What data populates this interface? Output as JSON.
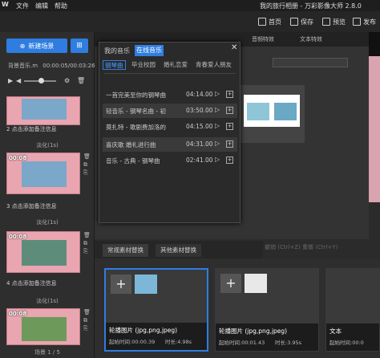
{
  "titlebar": {
    "logo": "W",
    "menus": [
      "文件",
      "编辑",
      "帮助"
    ],
    "title": "我的旅行相册 - 万彩影像大师 2.8.0"
  },
  "toolbar": {
    "home": "首页",
    "save": "保存",
    "preview": "预览",
    "publish": "发布"
  },
  "left": {
    "new_scene": "新建场景",
    "music_label": "背景音乐.m",
    "music_time": "00:00:05/00:03:26",
    "scenes": [
      {
        "caption": "2 点击添加备注信息",
        "time": "",
        "transition": "淡化(1s)"
      },
      {
        "caption": "3 点击添加备注信息",
        "time": "00:08",
        "transition": "淡化(1s)"
      },
      {
        "caption": "4 点击添加备注信息",
        "time": "00:08",
        "transition": "淡化(1s)"
      },
      {
        "caption": "",
        "time": "00:08",
        "transition": ""
      }
    ],
    "footer": "场景 1 / 5"
  },
  "top_tabs": [
    "音频特效",
    "文本特效"
  ],
  "dialog": {
    "tab_my": "我的音乐",
    "tab_online": "在线音乐",
    "close": "✕",
    "categories": [
      "钢琴曲",
      "毕业校园",
      "婚礼恋爱",
      "青春爱人朋友"
    ],
    "songs": [
      {
        "name": "一首完美至你的钢琴曲",
        "time": "04:14.00"
      },
      {
        "name": "轻音乐 - 钢琴名曲 - 初",
        "time": "03:50.00"
      },
      {
        "name": "莫扎特 - 歌剧费加洛的",
        "time": "04:15.00"
      },
      {
        "name": "喜庆歌 婚礼进行曲",
        "time": "04:31.00"
      },
      {
        "name": "音乐 - 古典 - 钢琴曲",
        "time": "02:41.00"
      }
    ]
  },
  "undo_row": "撤销 (Ctrl+Z)     重做 (Ctrl+Y)",
  "material_tabs": [
    "常规素材替换",
    "其他素材替换"
  ],
  "cards": [
    {
      "title": "轮播图片 (jpg,png,jpeg)",
      "start": "起始时间:00:00.39",
      "duration": "时长:4.98s"
    },
    {
      "title": "轮播图片 (jpg,png,jpeg)",
      "start": "起始时间:00:01.43",
      "duration": "时长:3.95s"
    },
    {
      "title": "文本",
      "start": "起始时间:00:0",
      "duration": ""
    }
  ],
  "colors": {
    "accent": "#2f7de1",
    "thumb_pink": "#e9a5b0"
  }
}
